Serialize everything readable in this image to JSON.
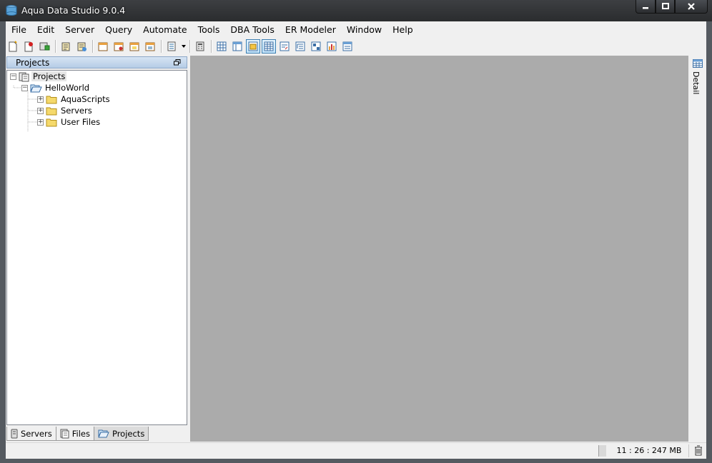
{
  "window": {
    "title": "Aqua Data Studio 9.0.4",
    "controls": {
      "minimize": "minimize",
      "maximize": "maximize",
      "close": "close"
    }
  },
  "menu": [
    "File",
    "Edit",
    "Server",
    "Query",
    "Automate",
    "Tools",
    "DBA Tools",
    "ER Modeler",
    "Window",
    "Help"
  ],
  "toolbar": {
    "icons": [
      "new-file-icon",
      "remove-icon",
      "register-server-icon",
      "properties-icon",
      "properties2-icon",
      "query-window-icon",
      "query-window2-icon",
      "query-window3-icon",
      "compare-icon",
      "script-icon",
      "dropdown-arrow-icon",
      "calculator-icon",
      "grid-view-icon",
      "table-view-icon",
      "folder-view-icon",
      "results-grid-icon",
      "text-view-icon",
      "tree-view-icon",
      "pivot-view-icon",
      "chart-view-icon",
      "form-view-icon"
    ]
  },
  "left_panel": {
    "title": "Projects",
    "tree": {
      "root": "Projects",
      "project": "HelloWorld",
      "children": [
        "AquaScripts",
        "Servers",
        "User Files"
      ]
    },
    "tabs": [
      "Servers",
      "Files",
      "Projects"
    ],
    "active_tab": "Projects"
  },
  "right_strip": {
    "label": "Detail"
  },
  "status": {
    "time_memory": "11 : 26 : 247 MB"
  },
  "colors": {
    "main_area": "#ababab",
    "panel_header": "#c6d8ed",
    "folder": "#f5d96b"
  }
}
